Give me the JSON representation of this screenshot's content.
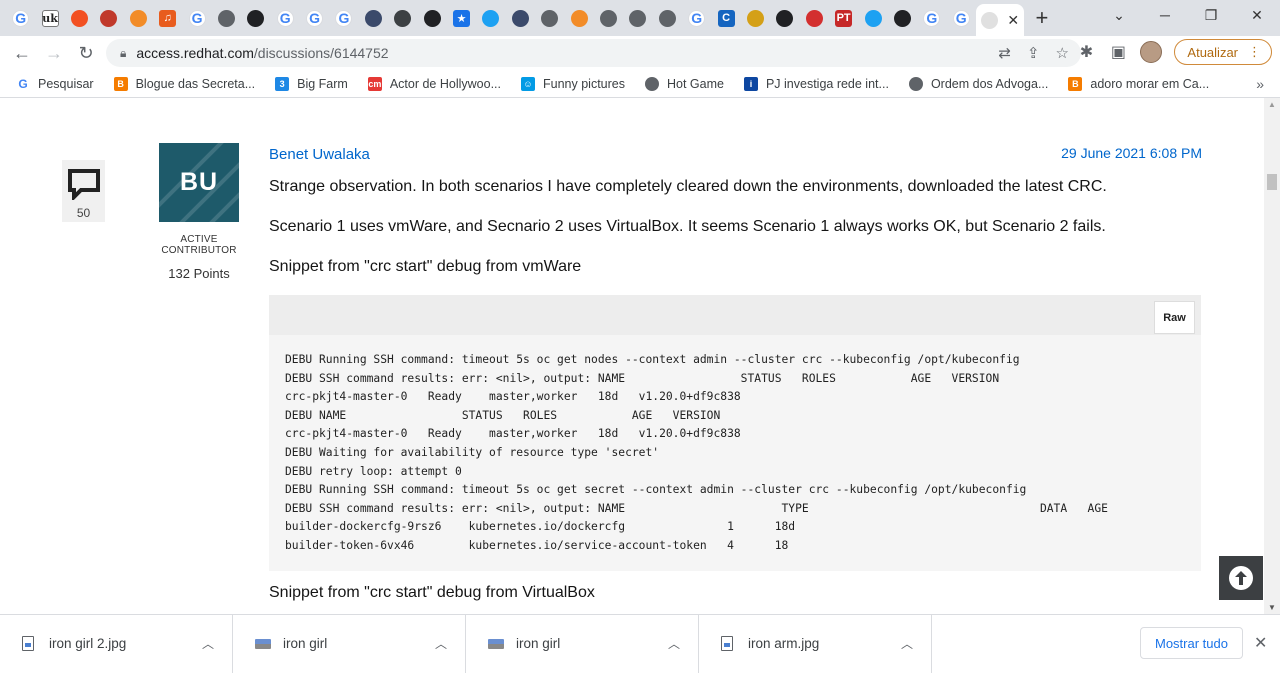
{
  "tabs": [
    {
      "icon": "google-icon",
      "glyph": "G",
      "color": "#4285f4"
    },
    {
      "icon": "uk-icon",
      "glyph": "uk",
      "color": "#ffffff"
    },
    {
      "icon": "microsoft-icon",
      "glyph": "",
      "color": "#f25022"
    },
    {
      "icon": "flag-icon",
      "glyph": "",
      "color": "#c0392b"
    },
    {
      "icon": "cube-icon",
      "glyph": "",
      "color": "#f28c28"
    },
    {
      "icon": "music-icon",
      "glyph": "♫",
      "color": "#e85c1e"
    },
    {
      "icon": "google-icon",
      "glyph": "G",
      "color": "#4285f4"
    },
    {
      "icon": "globe-icon",
      "glyph": "",
      "color": "#5f6368"
    },
    {
      "icon": "ninja-icon",
      "glyph": "",
      "color": "#202124"
    },
    {
      "icon": "google-icon",
      "glyph": "G",
      "color": "#4285f4"
    },
    {
      "icon": "google-icon",
      "glyph": "G",
      "color": "#4285f4"
    },
    {
      "icon": "google-icon",
      "glyph": "G",
      "color": "#4285f4"
    },
    {
      "icon": "person-icon",
      "glyph": "",
      "color": "#3b4a6b"
    },
    {
      "icon": "blocked-icon",
      "glyph": "",
      "color": "#3c4043"
    },
    {
      "icon": "github-icon",
      "glyph": "",
      "color": "#202124"
    },
    {
      "icon": "star-icon",
      "glyph": "★",
      "color": "#1a73e8"
    },
    {
      "icon": "twitter-icon",
      "glyph": "",
      "color": "#1da1f2"
    },
    {
      "icon": "person-icon",
      "glyph": "",
      "color": "#3b4a6b"
    },
    {
      "icon": "globe-icon",
      "glyph": "",
      "color": "#5f6368"
    },
    {
      "icon": "diamond-icon",
      "glyph": "",
      "color": "#f28c28"
    },
    {
      "icon": "globe-icon",
      "glyph": "",
      "color": "#5f6368"
    },
    {
      "icon": "globe-icon",
      "glyph": "",
      "color": "#5f6368"
    },
    {
      "icon": "globe-icon",
      "glyph": "",
      "color": "#5f6368"
    },
    {
      "icon": "google-icon",
      "glyph": "G",
      "color": "#4285f4"
    },
    {
      "icon": "c-icon",
      "glyph": "C",
      "color": "#1565c0"
    },
    {
      "icon": "cartoon-icon",
      "glyph": "",
      "color": "#d4a017"
    },
    {
      "icon": "github-icon",
      "glyph": "",
      "color": "#202124"
    },
    {
      "icon": "opera-icon",
      "glyph": "",
      "color": "#d32f2f"
    },
    {
      "icon": "pt-icon",
      "glyph": "PT",
      "color": "#c62828"
    },
    {
      "icon": "twitter-icon",
      "glyph": "",
      "color": "#1da1f2"
    },
    {
      "icon": "news-icon",
      "glyph": "",
      "color": "#202124"
    },
    {
      "icon": "google-icon",
      "glyph": "G",
      "color": "#4285f4"
    },
    {
      "icon": "google-icon",
      "glyph": "G",
      "color": "#4285f4"
    }
  ],
  "address": {
    "host": "access.redhat.com",
    "path": "/discussions/6144752"
  },
  "update_button": "Atualizar",
  "bookmarks": [
    {
      "label": "Pesquisar",
      "icon": "google-icon",
      "color": "#4285f4",
      "glyph": "G"
    },
    {
      "label": "Blogue das Secreta...",
      "icon": "blogger-icon",
      "color": "#f57c00",
      "glyph": "B"
    },
    {
      "label": "Big Farm",
      "icon": "bigfarm-icon",
      "color": "#1e88e5",
      "glyph": "3"
    },
    {
      "label": "Actor de Hollywoo...",
      "icon": "cm-icon",
      "color": "#e53935",
      "glyph": "cm"
    },
    {
      "label": "Funny pictures",
      "icon": "smile-icon",
      "color": "#039be5",
      "glyph": "☺"
    },
    {
      "label": "Hot Game",
      "icon": "globe-icon",
      "color": "#5f6368",
      "glyph": ""
    },
    {
      "label": "PJ investiga rede int...",
      "icon": "info-icon",
      "color": "#0d47a1",
      "glyph": "i"
    },
    {
      "label": "Ordem dos Advoga...",
      "icon": "globe-icon",
      "color": "#5f6368",
      "glyph": ""
    },
    {
      "label": "adoro morar em Ca...",
      "icon": "blogger-icon",
      "color": "#f57c00",
      "glyph": "B"
    }
  ],
  "post": {
    "reply_count": "50",
    "avatar_initials": "BU",
    "badge_line1": "ACTIVE",
    "badge_line2": "CONTRIBUTOR",
    "points": "132 Points",
    "author": "Benet Uwalaka",
    "date": "29 June 2021 6:08 PM",
    "p1": "Strange observation. In both scenarios I have completely cleared down the environments, downloaded the latest CRC.",
    "p2": "Scenario 1 uses vmWare, and Secnario 2 uses VirtualBox. It seems Scenario 1 always works OK, but Scenario 2 fails.",
    "p3": "Snippet from \"crc start\" debug from vmWare",
    "raw_label": "Raw",
    "code": "DEBU Running SSH command: timeout 5s oc get nodes --context admin --cluster crc --kubeconfig /opt/kubeconfig\nDEBU SSH command results: err: <nil>, output: NAME                 STATUS   ROLES           AGE   VERSION\ncrc-pkjt4-master-0   Ready    master,worker   18d   v1.20.0+df9c838\nDEBU NAME                 STATUS   ROLES           AGE   VERSION\ncrc-pkjt4-master-0   Ready    master,worker   18d   v1.20.0+df9c838\nDEBU Waiting for availability of resource type 'secret'\nDEBU retry loop: attempt 0\nDEBU Running SSH command: timeout 5s oc get secret --context admin --cluster crc --kubeconfig /opt/kubeconfig\nDEBU SSH command results: err: <nil>, output: NAME                       TYPE                                  DATA   AGE\nbuilder-dockercfg-9rsz6    kubernetes.io/dockercfg               1      18d\nbuilder-token-6vx46        kubernetes.io/service-account-token   4      18",
    "p4": "Snippet from \"crc start\" debug from VirtualBox"
  },
  "downloads": [
    {
      "name": "iron girl 2.jpg",
      "type": "file"
    },
    {
      "name": "iron girl",
      "type": "image"
    },
    {
      "name": "iron girl",
      "type": "image"
    },
    {
      "name": "iron arm.jpg",
      "type": "file"
    }
  ],
  "show_all": "Mostrar tudo"
}
